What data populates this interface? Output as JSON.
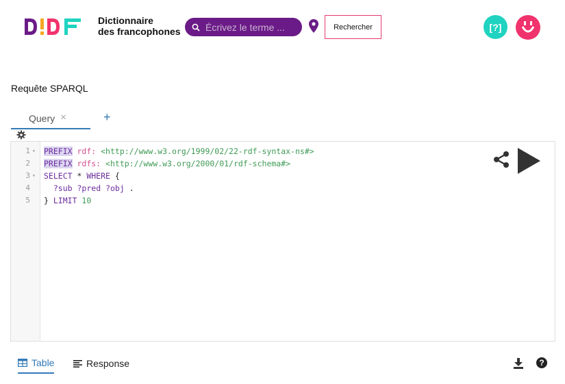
{
  "header": {
    "logo_text": "D!DF",
    "brand_line1": "Dictionnaire",
    "brand_line2": "des francophones",
    "search_placeholder": "Écrivez le terme ...",
    "search_button": "Rechercher",
    "help_button": "[?]",
    "icons": [
      "search-icon",
      "location-pin-icon",
      "smiley-icon"
    ],
    "colors": {
      "search_pill": "#6b1b87",
      "accent_pink": "#f0326d",
      "accent_teal": "#1fd3c0",
      "logo_teal": "#1fd3c0",
      "logo_purple": "#6b1b87",
      "logo_yellow": "#f5a623"
    }
  },
  "page": {
    "heading": "Requête SPARQL"
  },
  "editor": {
    "tabs": [
      {
        "label": "Query",
        "close": "×"
      }
    ],
    "add_tab": "+",
    "lines": [
      {
        "n": "1",
        "fold": "▾",
        "tokens": [
          {
            "t": "PREFIX",
            "c": "kw-hl"
          },
          {
            "t": " ",
            "c": ""
          },
          {
            "t": "rdf:",
            "c": "pfx"
          },
          {
            "t": " ",
            "c": ""
          },
          {
            "t": "<http://www.w3.org/1999/02/22-rdf-syntax-ns#>",
            "c": "iri"
          }
        ]
      },
      {
        "n": "2",
        "fold": "",
        "tokens": [
          {
            "t": "PREFIX",
            "c": "kw-hl"
          },
          {
            "t": " ",
            "c": ""
          },
          {
            "t": "rdfs:",
            "c": "pfx"
          },
          {
            "t": " ",
            "c": ""
          },
          {
            "t": "<http://www.w3.org/2000/01/rdf-schema#>",
            "c": "iri"
          }
        ]
      },
      {
        "n": "3",
        "fold": "▾",
        "tokens": [
          {
            "t": "SELECT",
            "c": "kw"
          },
          {
            "t": " * ",
            "c": ""
          },
          {
            "t": "WHERE",
            "c": "kw"
          },
          {
            "t": " {",
            "c": ""
          }
        ]
      },
      {
        "n": "4",
        "fold": "",
        "tokens": [
          {
            "t": "  ",
            "c": ""
          },
          {
            "t": "?sub",
            "c": "var"
          },
          {
            "t": " ",
            "c": ""
          },
          {
            "t": "?pred",
            "c": "var"
          },
          {
            "t": " ",
            "c": ""
          },
          {
            "t": "?obj",
            "c": "var"
          },
          {
            "t": " .",
            "c": ""
          }
        ]
      },
      {
        "n": "5",
        "fold": "",
        "tokens": [
          {
            "t": "} ",
            "c": ""
          },
          {
            "t": "LIMIT",
            "c": "kw"
          },
          {
            "t": " ",
            "c": ""
          },
          {
            "t": "10",
            "c": "num"
          }
        ]
      }
    ]
  },
  "results": {
    "tabs": [
      {
        "label": "Table",
        "active": true
      },
      {
        "label": "Response",
        "active": false
      }
    ],
    "help": "?"
  }
}
